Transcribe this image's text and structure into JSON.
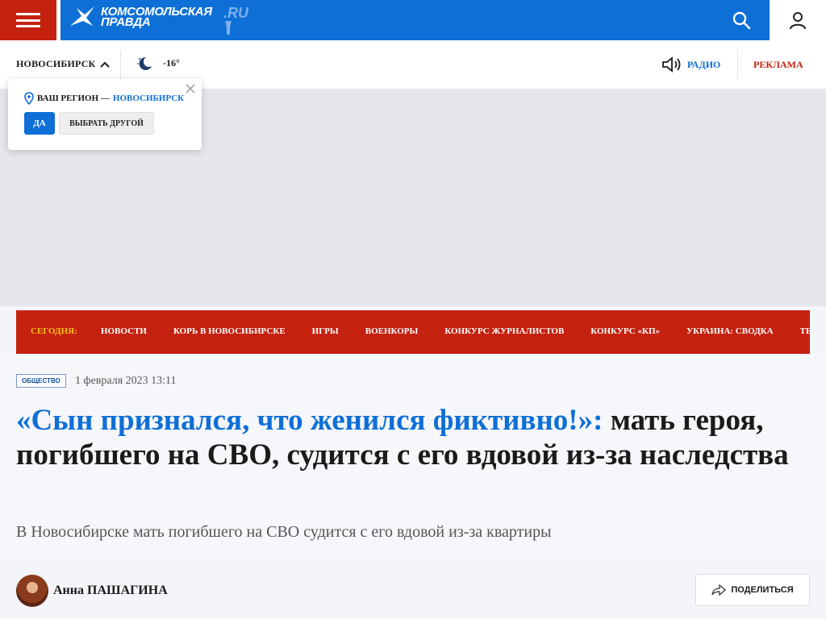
{
  "header": {
    "logo_line1": "комсомольская",
    "logo_line2": "правда",
    "logo_ru": ".RU"
  },
  "subbar": {
    "city": "НОВОСИБИРСК",
    "temperature": "-16°",
    "radio_label": "РАДИО",
    "ads_label": "РЕКЛАМА"
  },
  "region_popup": {
    "prefix": "ВАШ РЕГИОН —",
    "region": "НОВОСИБИРСК",
    "yes_label": "ДА",
    "other_label": "ВЫБРАТЬ ДРУГОЙ"
  },
  "nav": {
    "today_label": "СЕГОДНЯ:",
    "items": [
      "НОВОСТИ",
      "КОРЬ В НОВОСИБИРСКЕ",
      "ИГРЫ",
      "ВОЕНКОРЫ",
      "КОНКУРС ЖУРНАЛИСТОВ",
      "КОНКУРС «КП»",
      "УКРАИНА: СВОДКА",
      "ТЕХ"
    ]
  },
  "article": {
    "tag": "ОБЩЕСТВО",
    "date": "1 февраля 2023 13:11",
    "title_accent": "«Сын признался, что женился фиктивно!»:",
    "title_rest": " мать героя, погибшего на СВО, судится с его вдовой из-за наследства",
    "lead": "В Новосибирске мать погибшего на СВО судится с его вдовой из-за квартиры",
    "author_first": "Анна",
    "author_last": "ПАШАГИНА",
    "share_label": "ПОДЕЛИТЬСЯ"
  },
  "colors": {
    "brand_blue": "#0e6fd7",
    "brand_red": "#c4210f",
    "nav_today": "#f6c21a"
  }
}
